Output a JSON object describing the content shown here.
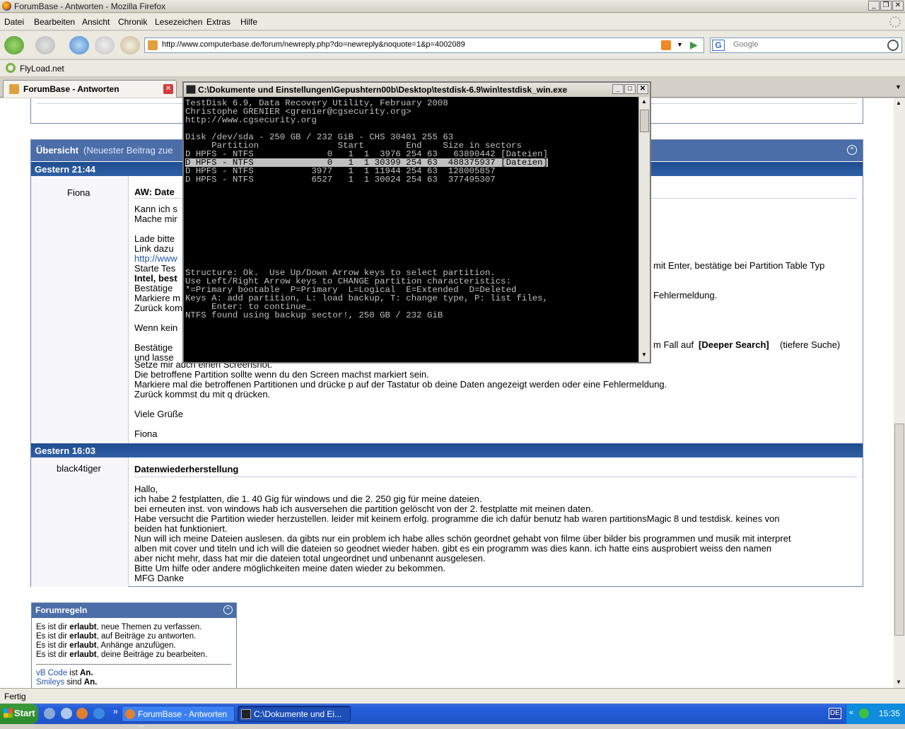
{
  "window": {
    "title": "ForumBase - Antworten - Mozilla Firefox"
  },
  "menu": [
    "Datei",
    "Bearbeiten",
    "Ansicht",
    "Chronik",
    "Lesezeichen",
    "Extras",
    "Hilfe"
  ],
  "nav": {
    "url": "http://www.computerbase.de/forum/newreply.php?do=newreply&noquote=1&p=4002089",
    "search_placeholder": "Google"
  },
  "bookmarks": {
    "item": "FlyLoad.net"
  },
  "tab": {
    "label": "ForumBase - Antworten"
  },
  "overview": {
    "title": "Übersicht",
    "subtitle": "(Neuester Beitrag zue"
  },
  "post1": {
    "date": "Gestern 21:44",
    "author": "Fiona",
    "subject": "AW: Date",
    "lines": [
      "Kann ich s",
      "Mache mir",
      "",
      "Lade bitte",
      "Link dazu",
      "http://www",
      "Starte Tes",
      "Intel, best",
      "Bestätige",
      "Markiere m",
      "Zurück kom",
      "",
      "Wenn kein",
      "",
      "Bestätige",
      "und lasse"
    ],
    "right_fragments": [
      "mit Enter, bestätige bei Partition Table Typ",
      "Fehlermeldung.",
      "m Fall auf",
      "[Deeper Search]",
      "(tiefere Suche)"
    ],
    "tail_lines": [
      "Setze mir auch einen Screenshot.",
      "Die betroffene Partition sollte wenn du den Screen machst markiert sein.",
      "Markiere mal die betroffenen Partitionen und drücke p auf der Tastatur ob deine Daten angezeigt werden oder eine Fehlermeldung.",
      "Zurück kommst du mit q drücken.",
      "",
      "Viele Grüße",
      "",
      "Fiona"
    ]
  },
  "post2": {
    "date": "Gestern 16:03",
    "author": "black4tiger",
    "subject": "Datenwiederherstellung",
    "lines": [
      "Hallo,",
      "ich habe 2 festplatten, die 1. 40 Gig für windows und die 2. 250 gig für meine dateien.",
      "bei erneuten inst. von windows hab ich ausversehen die partition gelöscht von der 2. festplatte mit meinen daten.",
      "Habe versucht die Partition wieder herzustellen. leider mit keinem erfolg. programme die ich dafür benutz hab waren partitionsMagic 8 und testdisk. keines von",
      "beiden hat funktioniert.",
      "Nun will ich meine Dateien auslesen. da gibts nur ein problem ich habe alles schön geordnet gehabt von filme über bilder bis programmen und musik mit interpret",
      "alben mit cover und titeln und ich will die dateien so geodnet wieder haben. gibt es ein programm was dies kann. ich hatte eins ausprobiert weiss den namen",
      "aber nicht mehr, dass hat mir die dateien total ungeordnet und unbenannt ausgelesen.",
      "Bitte Um hilfe oder andere möglichkeiten meine daten wieder zu bekommen.",
      "MFG Danke"
    ]
  },
  "rules": {
    "title": "Forumregeln",
    "lines": [
      {
        "pre": "Es ist dir ",
        "bold": "erlaubt",
        "post": ", neue Themen zu verfassen."
      },
      {
        "pre": "Es ist dir ",
        "bold": "erlaubt",
        "post": ", auf Beiträge zu antworten."
      },
      {
        "pre": "Es ist dir ",
        "bold": "erlaubt",
        "post": ", Anhänge anzufügen."
      },
      {
        "pre": "Es ist dir ",
        "bold": "erlaubt",
        "post": ", deine Beiträge zu bearbeiten."
      }
    ],
    "vbcode_link": "vB Code",
    "vbcode_state": "An.",
    "smileys_link": "Smileys",
    "smileys_state": "An.",
    "ist": " ist ",
    "sind": " sind "
  },
  "status": "Fertig",
  "taskbar": {
    "start": "Start",
    "tasks": [
      "ForumBase - Antworten ...",
      "C:\\Dokumente und Ei..."
    ],
    "lang": "DE",
    "time": "15:35"
  },
  "console": {
    "title": "C:\\Dokumente und Einstellungen\\Gepushtern00b\\Desktop\\testdisk-6.9\\win\\testdisk_win.exe",
    "lines": [
      "TestDisk 6.9, Data Recovery Utility, February 2008",
      "Christophe GRENIER <grenier@cgsecurity.org>",
      "http://www.cgsecurity.org",
      "",
      "Disk /dev/sda - 250 GB / 232 GiB - CHS 30401 255 63",
      "     Partition               Start        End    Size in sectors",
      "D HPFS - NTFS              0   1  1  3976 254 63   63890442 [Dateien]",
      "D HPFS - NTFS              0   1  1 30399 254 63  488375937 [Dateien]",
      "D HPFS - NTFS           3977   1  1 11944 254 63  128005857",
      "D HPFS - NTFS           6527   1  1 30024 254 63  377495307",
      "",
      "",
      "",
      "",
      "",
      "",
      "",
      "",
      "",
      "",
      "Structure: Ok.  Use Up/Down Arrow keys to select partition.",
      "Use Left/Right Arrow keys to CHANGE partition characteristics:",
      "*=Primary bootable  P=Primary  L=Logical  E=Extended  D=Deleted",
      "Keys A: add partition, L: load backup, T: change type, P: list files,",
      "     Enter: to continue_",
      "NTFS found using backup sector!, 250 GB / 232 GiB"
    ]
  }
}
